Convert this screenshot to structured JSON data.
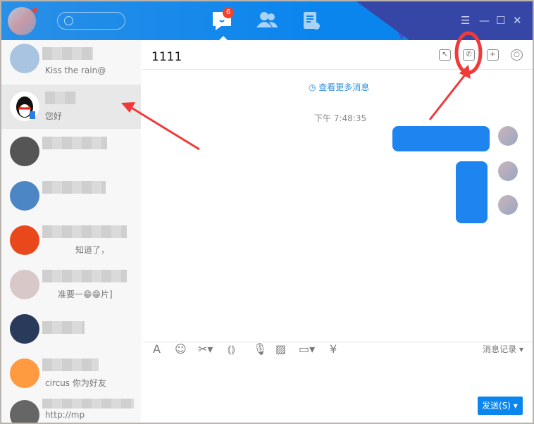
{
  "header": {
    "unread_badge": "6",
    "nav": [
      "messages",
      "contacts",
      "files"
    ]
  },
  "window_controls": {
    "menu": "☰",
    "minimize": "—",
    "maximize": "☐",
    "close": "✕"
  },
  "contacts": [
    {
      "preview": "Kiss the rain@"
    },
    {
      "preview": "您好"
    },
    {
      "preview": ""
    },
    {
      "preview": ""
    },
    {
      "preview": "知道了，"
    },
    {
      "preview": "准要一😁😁片]"
    },
    {
      "preview": ""
    },
    {
      "preview": "circus 你为好友"
    },
    {
      "preview": "http://mp"
    }
  ],
  "chat": {
    "title": "1111",
    "more_messages": "查看更多消息",
    "timestamp": "下午 7:48:35",
    "history": "消息记录 ▾",
    "send": "发送(S)"
  },
  "colors": {
    "accent": "#0a86ee",
    "annotation": "#f03a3a"
  }
}
